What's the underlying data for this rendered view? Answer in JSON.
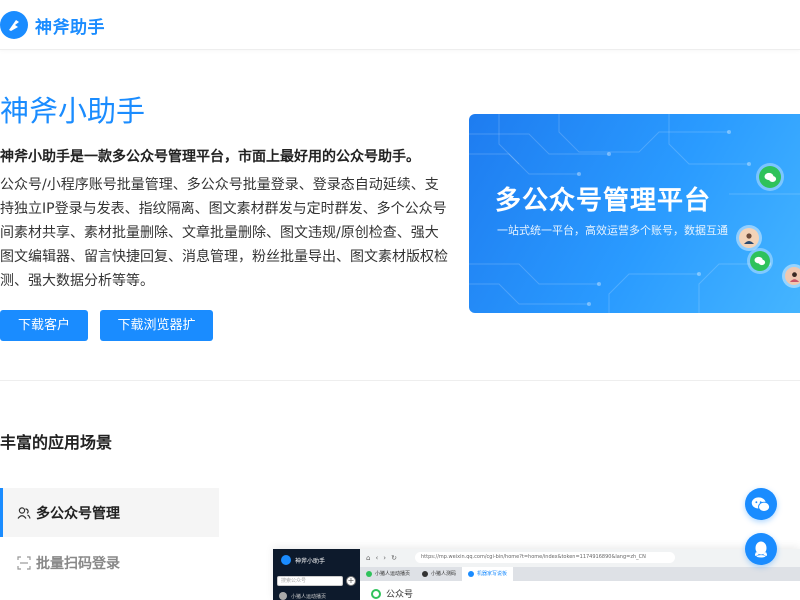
{
  "header": {
    "logo_text": "神斧助手"
  },
  "hero": {
    "title": "神斧小助手",
    "subtitle": "神斧小助手是一款多公众号管理平台，市面上最好用的公众号助手。",
    "description": "公众号/小程序账号批量管理、多公众号批量登录、登录态自动延续、支持独立IP登录与发表、指纹隔离、图文素材群发与定时群发、多个公众号间素材共享、素材批量删除、文章批量删除、图文违规/原创检查、强大图文编辑器、留言快捷回复、消息管理，粉丝批量导出、图文素材版权检测、强大数据分析等等。",
    "buttons": {
      "download_client": "下载客户端",
      "download_extension": "下载浏览器扩展"
    }
  },
  "banner": {
    "title": "多公众号管理平台",
    "subtitle": "一站式统一平台，高效运营多个账号，数据互通"
  },
  "scenarios": {
    "title": "丰富的应用场景",
    "tabs": [
      {
        "label": "多公众号管理",
        "active": true,
        "icon": "users-icon"
      },
      {
        "label": "批量扫码登录",
        "active": false,
        "icon": "scan-icon"
      }
    ]
  },
  "preview": {
    "brand": "神斧小助手",
    "search_placeholder": "搜索公众号",
    "account": "小猪人运动播页",
    "url": "https://mp.weixin.qq.com/cgi-bin/home?t=home/index&token=1174916890&lang=zh_CN",
    "tabs": [
      "小猪人运动播页",
      "小猪人测码",
      "机器家写说板"
    ],
    "section": "公众号"
  },
  "colors": {
    "accent": "#1a8cff",
    "wechat_green": "#2fc25b"
  }
}
